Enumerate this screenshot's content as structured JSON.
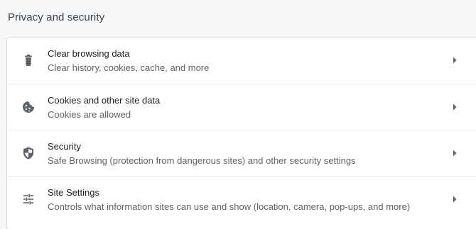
{
  "section": {
    "title": "Privacy and security"
  },
  "items": [
    {
      "label": "Clear browsing data",
      "sublabel": "Clear history, cookies, cache, and more",
      "icon": "trash-icon"
    },
    {
      "label": "Cookies and other site data",
      "sublabel": "Cookies are allowed",
      "icon": "cookie-icon"
    },
    {
      "label": "Security",
      "sublabel": "Safe Browsing (protection from dangerous sites) and other security settings",
      "icon": "shield-icon"
    },
    {
      "label": "Site Settings",
      "sublabel": "Controls what information sites can use and show (location, camera, pop-ups, and more)",
      "icon": "tune-sliders-icon"
    }
  ],
  "colors": {
    "background": "#f7f8fa",
    "card": "#ffffff",
    "icon": "#5f6368",
    "primary_text": "#202124",
    "secondary_text": "#5f6368"
  }
}
